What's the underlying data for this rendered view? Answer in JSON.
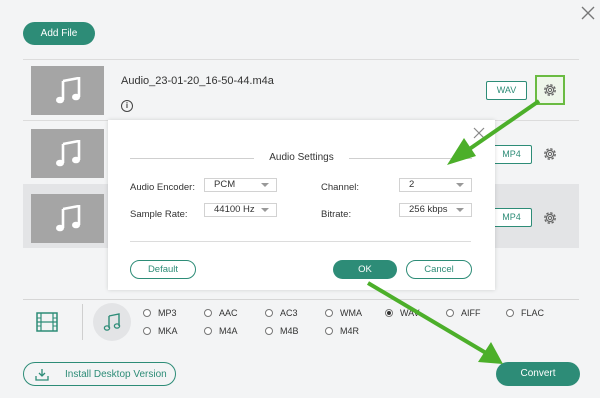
{
  "toolbar": {
    "add_file_label": "Add File"
  },
  "files": [
    {
      "name": "Audio_23-01-20_16-50-44.m4a",
      "format": "WAV"
    },
    {
      "format": "MP4"
    },
    {
      "format": "MP4"
    }
  ],
  "format_panel": {
    "options_row1": [
      "MP3",
      "AAC",
      "AC3",
      "WMA",
      "WAV",
      "AIFF",
      "FLAC"
    ],
    "options_row2": [
      "MKA",
      "M4A",
      "M4B",
      "M4R"
    ],
    "selected": "WAV"
  },
  "bottom": {
    "install_label": "Install Desktop Version",
    "convert_label": "Convert"
  },
  "dialog": {
    "title": "Audio Settings",
    "encoder_label": "Audio Encoder:",
    "encoder_value": "PCM",
    "channel_label": "Channel:",
    "channel_value": "2",
    "sample_rate_label": "Sample Rate:",
    "sample_rate_value": "44100 Hz",
    "bitrate_label": "Bitrate:",
    "bitrate_value": "256 kbps",
    "default_label": "Default",
    "ok_label": "OK",
    "cancel_label": "Cancel"
  },
  "colors": {
    "accent": "#2d8c77",
    "highlight": "#6abb42",
    "arrow": "#4caf2a"
  }
}
